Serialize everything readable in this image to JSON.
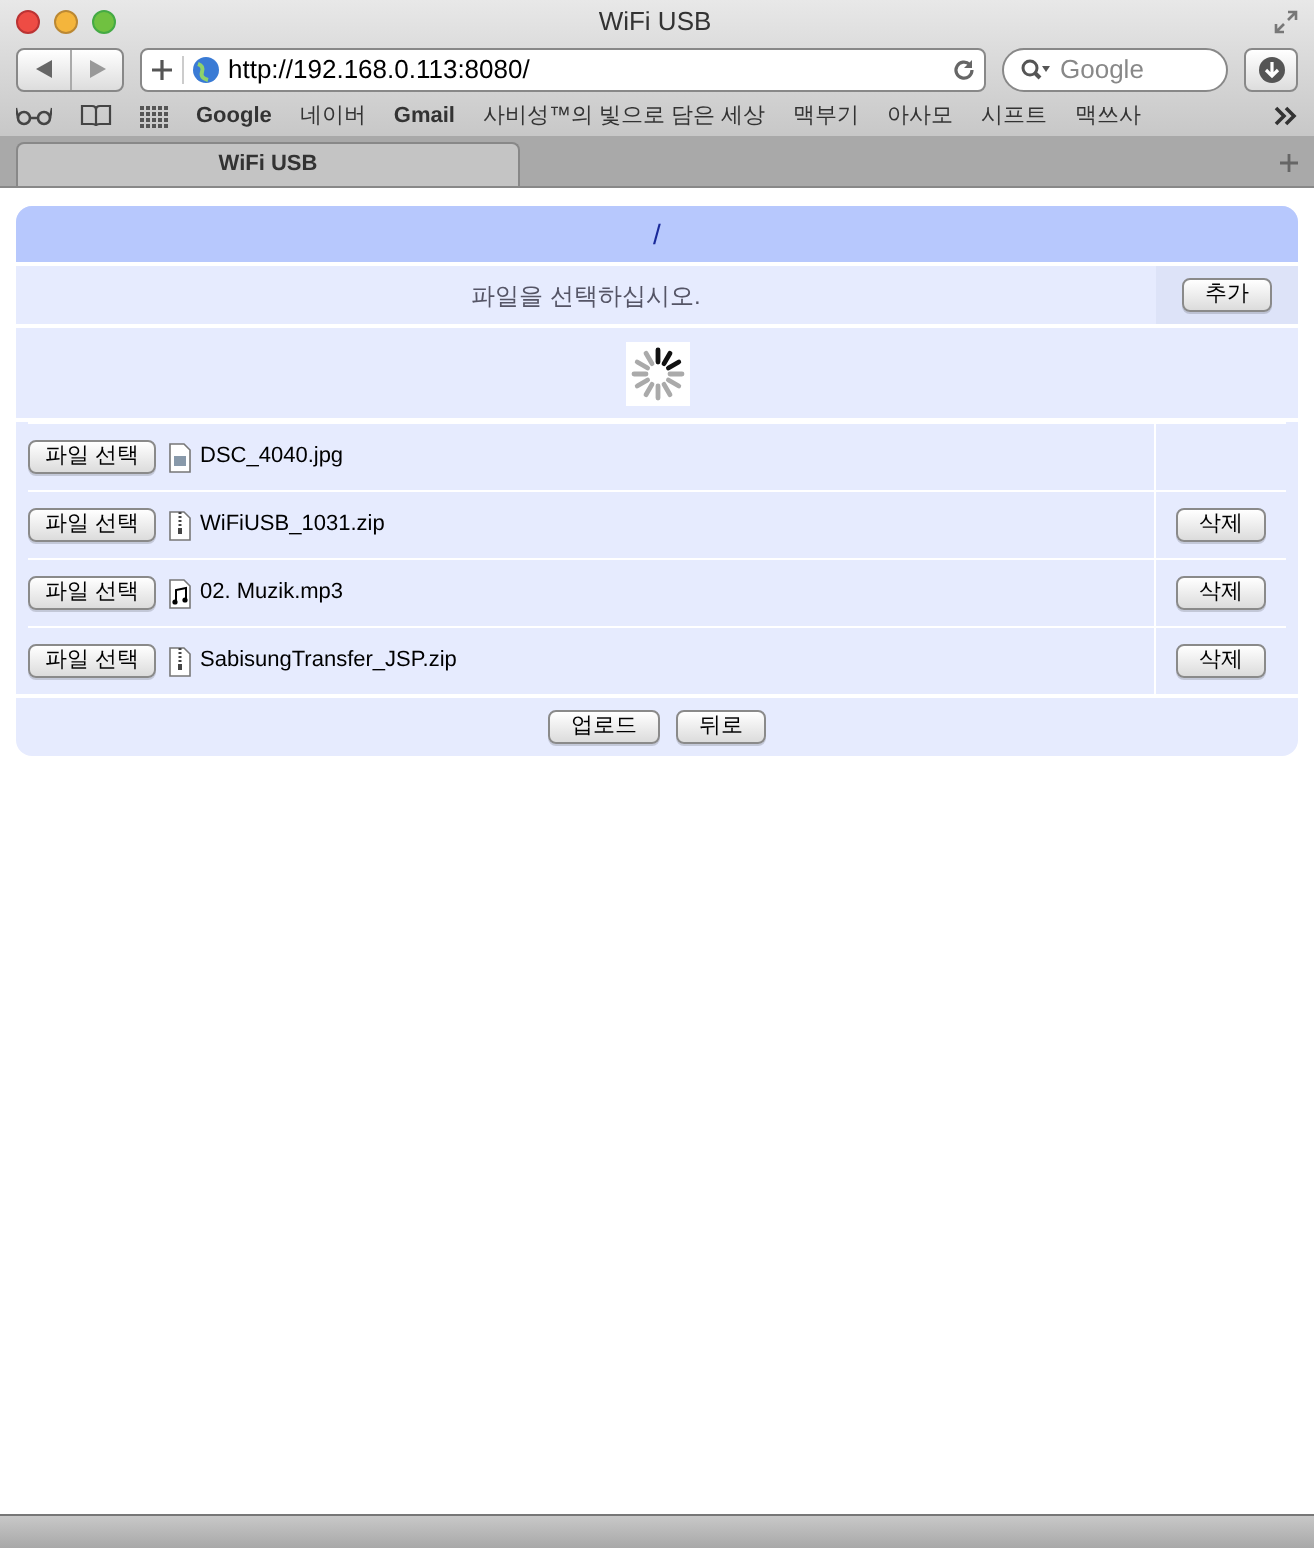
{
  "window": {
    "title": "WiFi USB"
  },
  "toolbar": {
    "url": "http://192.168.0.113:8080/",
    "search_placeholder": "Google"
  },
  "bookmarks": [
    "Google",
    "네이버",
    "Gmail",
    "사비성™의 빛으로 담은 세상",
    "맥부기",
    "아사모",
    "시프트",
    "맥쓰사"
  ],
  "tabs": [
    {
      "label": "WiFi USB",
      "selected": true
    }
  ],
  "page": {
    "path": "/",
    "prompt": "파일을 선택하십시오.",
    "add_button": "추가",
    "loading": true,
    "files": [
      {
        "choose_button": "파일 선택",
        "name": "DSC_4040.jpg",
        "kind": "image"
      },
      {
        "choose_button": "파일 선택",
        "name": "WiFiUSB_1031.zip",
        "kind": "zip",
        "delete_button": "삭제"
      },
      {
        "choose_button": "파일 선택",
        "name": "02. Muzik.mp3",
        "kind": "audio",
        "delete_button": "삭제"
      },
      {
        "choose_button": "파일 선택",
        "name": "SabisungTransfer_JSP.zip",
        "kind": "zip",
        "delete_button": "삭제"
      }
    ],
    "upload_button": "업로드",
    "back_button": "뒤로"
  }
}
